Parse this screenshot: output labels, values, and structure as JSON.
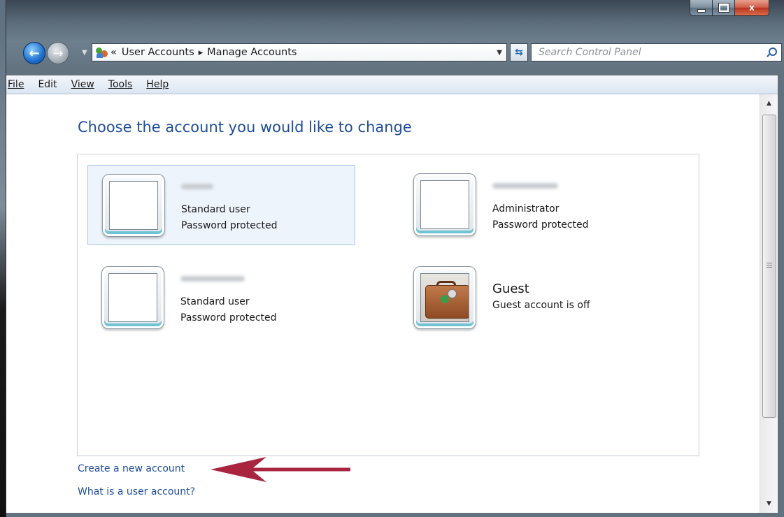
{
  "window": {
    "caption_minimize": "minimize",
    "caption_maximize": "maximize",
    "caption_close": "x"
  },
  "address": {
    "breadcrumb_overflow": "«",
    "crumb1": "User Accounts",
    "separator": "▸",
    "crumb2": "Manage Accounts"
  },
  "search": {
    "placeholder": "Search Control Panel"
  },
  "menu": {
    "file": "File",
    "edit": "Edit",
    "view": "View",
    "tools": "Tools",
    "help": "Help"
  },
  "page": {
    "title": "Choose the account you would like to change"
  },
  "accounts": [
    {
      "type": "Standard user",
      "status": "Password protected",
      "selected": true
    },
    {
      "type": "Administrator",
      "status": "Password protected",
      "selected": false
    },
    {
      "type": "Standard user",
      "status": "Password protected",
      "selected": false
    },
    {
      "name": "Guest",
      "status": "Guest account is off",
      "selected": false
    }
  ],
  "links": {
    "create": "Create a new account",
    "what": "What is a user account?"
  },
  "colors": {
    "link": "#1e4d98",
    "title": "#1e4d98",
    "annotation_arrow": "#a8243f"
  }
}
